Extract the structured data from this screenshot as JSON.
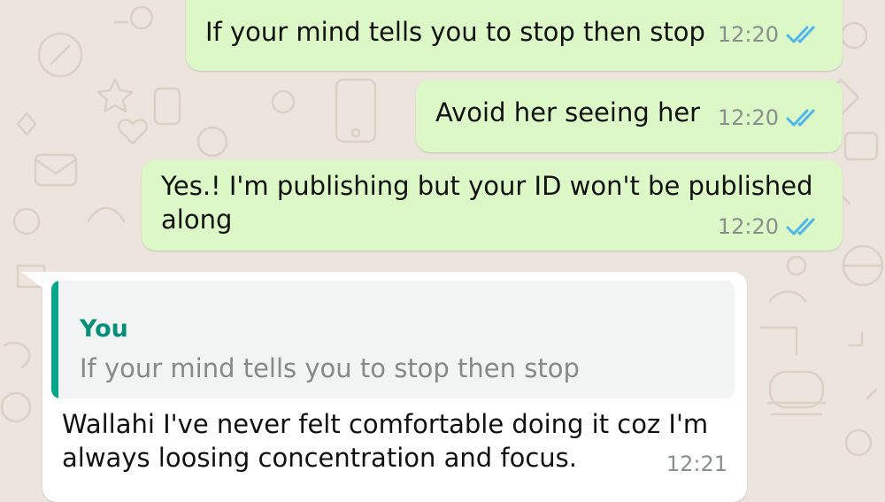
{
  "chat": {
    "messages": [
      {
        "direction": "outgoing",
        "text": "If your mind tells you to stop then stop",
        "time": "12:20",
        "status": "read",
        "status_icon": "double-check-icon"
      },
      {
        "direction": "outgoing",
        "text": "Avoid her seeing her",
        "time": "12:20",
        "status": "read",
        "status_icon": "double-check-icon"
      },
      {
        "direction": "outgoing",
        "lines": [
          "Yes.! I'm publishing but your ID won't be published",
          "along"
        ],
        "time": "12:20",
        "status": "read",
        "status_icon": "double-check-icon"
      },
      {
        "direction": "incoming",
        "quote": {
          "author": "You",
          "text": "If your mind tells you to stop then stop"
        },
        "lines": [
          "Wallahi I've never felt comfortable doing it coz I'm",
          "always loosing concentration and focus."
        ],
        "time": "12:21"
      }
    ]
  },
  "colors": {
    "wallpaper": "#ece5dd",
    "outgoing_bubble": "#dcf8c6",
    "incoming_bubble": "#ffffff",
    "read_ticks": "#4fb6ec",
    "quote_accent": "#06a68d"
  }
}
